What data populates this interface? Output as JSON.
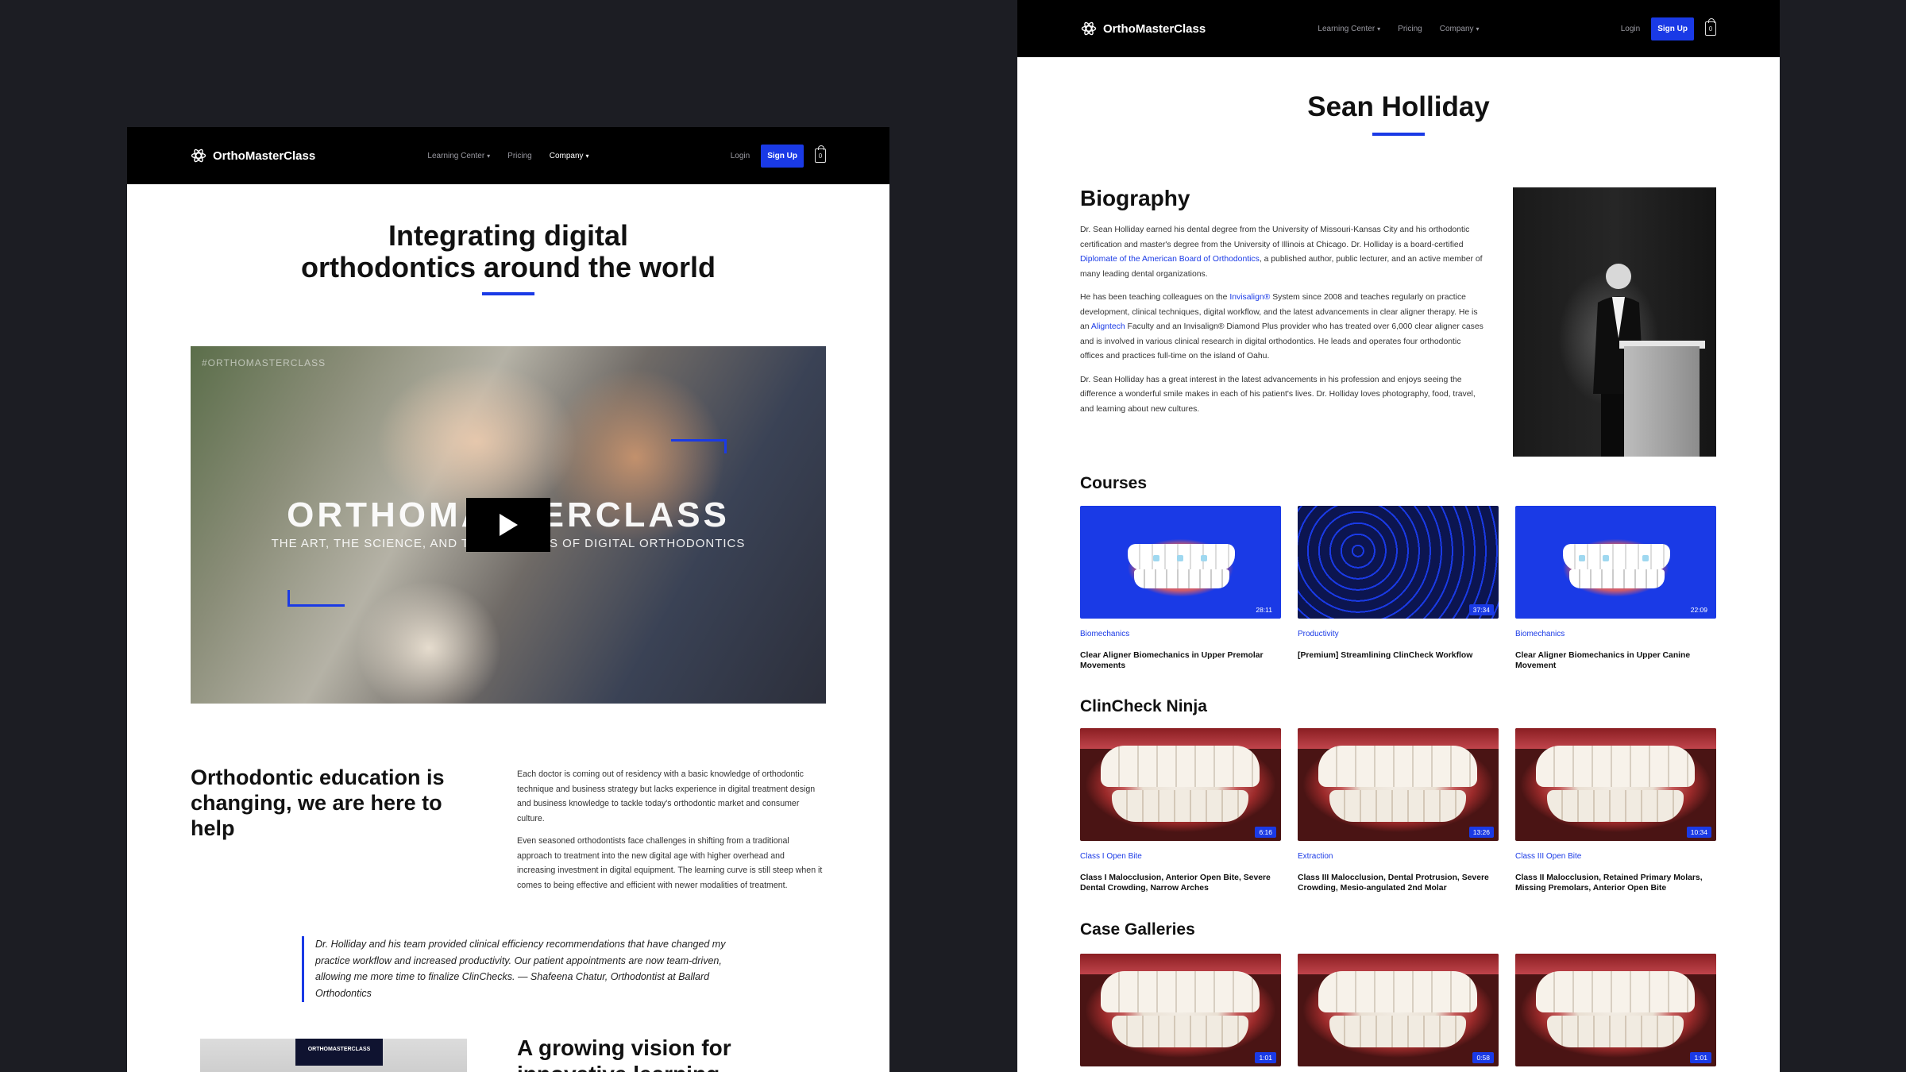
{
  "nav": {
    "brand": "OrthoMasterClass",
    "links": [
      "Learning Center",
      "Pricing",
      "Company"
    ],
    "login": "Login",
    "signup": "Sign Up",
    "cart_count": "0"
  },
  "left": {
    "hero_line1": "Integrating digital",
    "hero_line2": "orthodontics around the world",
    "video": {
      "watermark": "#ORTHOMASTERCLASS",
      "big_text": "ORTHOMASTERCLASS",
      "sub_text": "THE ART, THE SCIENCE, AND THE BUSINESS OF DIGITAL ORTHODONTICS"
    },
    "edu_title": "Orthodontic education is changing, we are here to help",
    "edu_p1": "Each doctor is coming out of residency with a basic knowledge of orthodontic technique and business strategy but lacks experience in digital treatment design and business knowledge to tackle today's orthodontic market and consumer culture.",
    "edu_p2": "Even seasoned orthodontists face challenges in shifting from a traditional approach to treatment into the new digital age with higher overhead and increasing investment in digital equipment. The learning curve is still steep when it comes to being effective and efficient with newer modalities of treatment.",
    "quote": "Dr. Holliday and his team provided clinical efficiency recommendations that have changed my practice workflow and increased productivity. Our patient appointments are now team-driven, allowing me more time to finalize ClinChecks. — Shafeena Chatur, Orthodontist at Ballard Orthodontics",
    "team_banner": "ORTHOMASTERCLASS",
    "vision_title": "A growing vision for innovative learning"
  },
  "right": {
    "name": "Sean Holliday",
    "bio_title": "Biography",
    "bio_p1_a": "Dr. Sean Holliday earned his dental degree from the University of Missouri-Kansas City and his orthodontic certification and master's degree from the University of Illinois at Chicago. Dr. Holliday is a board-certified ",
    "bio_p1_link": "Diplomate of the American Board of Orthodontics",
    "bio_p1_b": ", a published author, public lecturer, and an active member of many leading dental organizations.",
    "bio_p2_a": "He has been teaching colleagues on the ",
    "bio_p2_link1": "Invisalign®",
    "bio_p2_b": " System since 2008 and teaches regularly on practice development, clinical techniques, digital workflow, and the latest advancements in clear aligner therapy. He is an ",
    "bio_p2_link2": "Aligntech",
    "bio_p2_c": " Faculty and an Invisalign® Diamond Plus provider who has treated over 6,000 clear aligner cases and is involved in various clinical research in digital orthodontics. He leads and operates four orthodontic offices and practices full-time on the island of Oahu.",
    "bio_p3": "Dr. Sean Holliday has a great interest in the latest advancements in his profession and enjoys seeing the difference a wonderful smile makes in each of his patient's lives. Dr. Holliday loves photography, food, travel, and learning about new cultures.",
    "courses_title": "Courses",
    "courses": [
      {
        "duration": "28:11",
        "category": "Biomechanics",
        "title": "Clear Aligner Biomechanics in Upper Premolar Movements"
      },
      {
        "duration": "37:34",
        "category": "Productivity",
        "title": "[Premium] Streamlining ClinCheck Workflow"
      },
      {
        "duration": "22:09",
        "category": "Biomechanics",
        "title": "Clear Aligner Biomechanics in Upper Canine Movement"
      }
    ],
    "ninja_title": "ClinCheck Ninja",
    "ninja": [
      {
        "duration": "6:16",
        "category": "Class I Open Bite",
        "title": "Class I Malocclusion, Anterior Open Bite, Severe Dental Crowding, Narrow Arches"
      },
      {
        "duration": "13:26",
        "category": "Extraction",
        "title": "Class III Malocclusion, Dental Protrusion, Severe Crowding, Mesio-angulated 2nd Molar"
      },
      {
        "duration": "10:34",
        "category": "Class III Open Bite",
        "title": "Class II Malocclusion, Retained Primary Molars, Missing Premolars, Anterior Open Bite"
      }
    ],
    "galleries_title": "Case Galleries",
    "galleries": [
      {
        "duration": "1:01"
      },
      {
        "duration": "0:58"
      },
      {
        "duration": "1:01"
      }
    ]
  },
  "colors": {
    "accent": "#1a3ae6",
    "nav_bg": "#000000",
    "page_bg": "#1c1d23"
  }
}
